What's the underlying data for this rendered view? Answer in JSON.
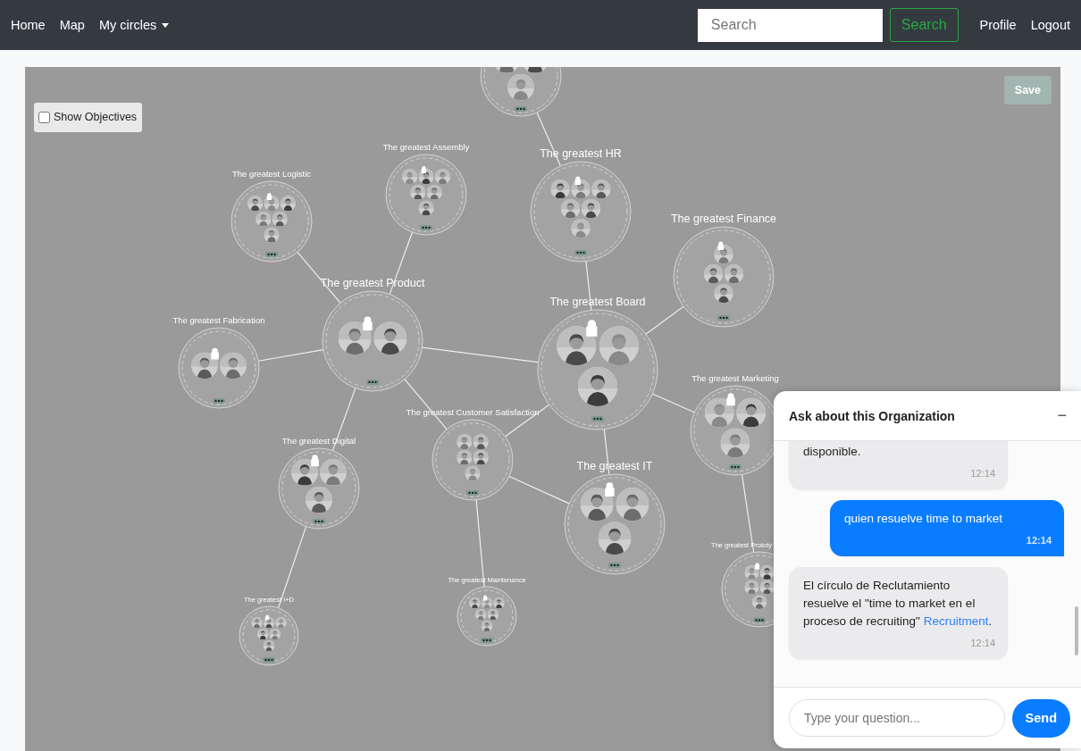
{
  "navbar": {
    "links": [
      {
        "label": "Home"
      },
      {
        "label": "Map"
      }
    ],
    "dropdown": {
      "label": "My circles"
    },
    "search": {
      "placeholder": "Search"
    },
    "search_button": "Search",
    "right_links": [
      {
        "label": "Profile"
      },
      {
        "label": "Logout"
      }
    ]
  },
  "map": {
    "show_objectives": {
      "label": "Show Objectives",
      "checked": false
    },
    "save_button": "Save",
    "circles": [
      {
        "locked": false
      },
      {
        "title": "The greatest Logistic",
        "locked": true
      },
      {
        "title": "The greatest Assembly",
        "locked": true
      },
      {
        "title": "The greatest HR",
        "locked": true
      },
      {
        "title": "The greatest Finance",
        "locked": true
      },
      {
        "title": "The greatest Fabrication",
        "locked": true
      },
      {
        "title": "The greatest Product",
        "locked": true
      },
      {
        "title": "The greatest Board",
        "locked": true
      },
      {
        "title": "The greatest Marketing",
        "locked": true
      },
      {
        "title": "The greatest Digital",
        "locked": true
      },
      {
        "title": "The greatest Customer Satisfaction",
        "locked": false
      },
      {
        "title": "The greatest IT",
        "locked": true
      },
      {
        "title": "The greatest I+D",
        "locked": true
      },
      {
        "title": "The greatest Maintenance",
        "locked": true
      },
      {
        "title": "The greatest Prototy",
        "locked": true
      }
    ]
  },
  "chat": {
    "title": "Ask about this Organization",
    "minimize": "−",
    "messages": [
      {
        "kind": "bot",
        "text": "disponible.",
        "time": "12:14"
      },
      {
        "kind": "user",
        "text": "quien resuelve time to market",
        "time": "12:14"
      },
      {
        "kind": "bot",
        "text": "El círculo de Reclutamiento resuelve el \"time to market en el proceso de recruiting\"",
        "link": "Recruitment",
        "after": ".",
        "time": "12:14"
      }
    ],
    "input": {
      "placeholder": "Type your question..."
    },
    "send_button": "Send"
  }
}
